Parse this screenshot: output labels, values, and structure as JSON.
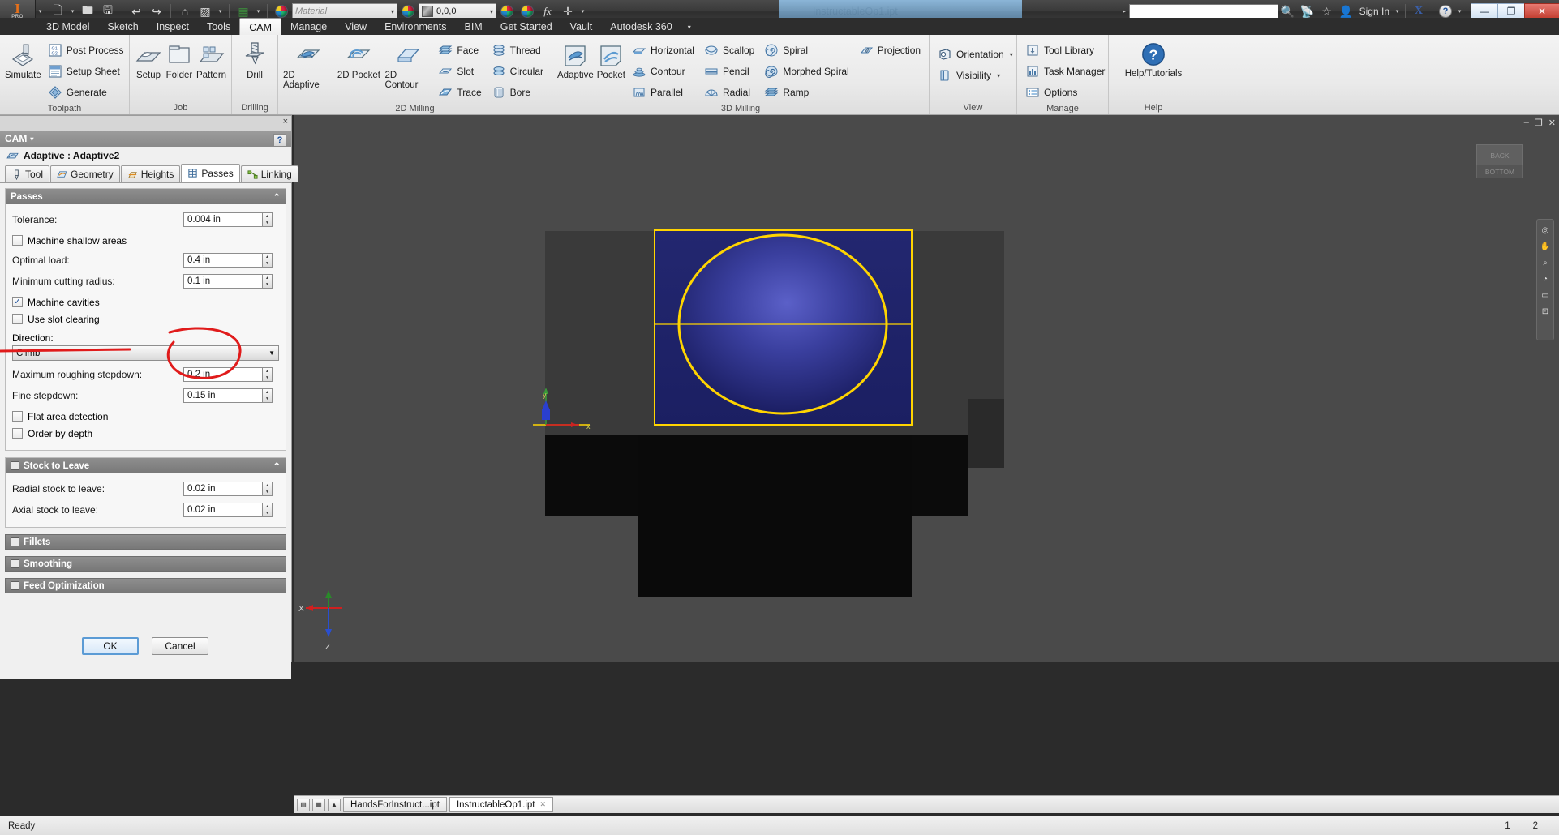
{
  "window": {
    "title": "InstructableOp1.ipt",
    "app_badge": "PRO",
    "app_letter": "I",
    "minimize": "—",
    "restore": "❐",
    "close": "✕",
    "sign_in": "Sign In",
    "help_label": "?",
    "exchange_label": "X"
  },
  "quick_access": {
    "material_placeholder": "Material",
    "appearance_value": "0,0,0",
    "items": [
      {
        "name": "new-icon",
        "glyph": "🗋"
      },
      {
        "name": "open-icon",
        "glyph": "🖿"
      },
      {
        "name": "save-icon",
        "glyph": "🖫"
      },
      {
        "name": "undo-icon",
        "glyph": "↩"
      },
      {
        "name": "redo-icon",
        "glyph": "↪"
      },
      {
        "name": "home-icon",
        "glyph": "⌂"
      },
      {
        "name": "return-icon",
        "glyph": "◳"
      },
      {
        "name": "update-icon",
        "glyph": "▣"
      },
      {
        "name": "appearance-icon",
        "glyph": "◉"
      }
    ],
    "extra": [
      {
        "name": "adjust-icon",
        "glyph": "◍"
      },
      {
        "name": "clear-icon",
        "glyph": "◍"
      },
      {
        "name": "fx-icon",
        "glyph": "fx"
      },
      {
        "name": "add-icon",
        "glyph": "✛"
      },
      {
        "name": "more-icon",
        "glyph": "▾"
      }
    ]
  },
  "menu": {
    "tabs": [
      {
        "label": "3D Model",
        "active": false
      },
      {
        "label": "Sketch",
        "active": false
      },
      {
        "label": "Inspect",
        "active": false
      },
      {
        "label": "Tools",
        "active": false
      },
      {
        "label": "CAM",
        "active": true
      },
      {
        "label": "Manage",
        "active": false
      },
      {
        "label": "View",
        "active": false
      },
      {
        "label": "Environments",
        "active": false
      },
      {
        "label": "BIM",
        "active": false
      },
      {
        "label": "Get Started",
        "active": false
      },
      {
        "label": "Vault",
        "active": false
      },
      {
        "label": "Autodesk 360",
        "active": false
      }
    ],
    "overflow_caret": "▾"
  },
  "ribbon": {
    "groups": [
      {
        "label": "Toolpath",
        "big": [
          {
            "label": "Simulate",
            "icon": "simulate-icon"
          }
        ],
        "small": [
          {
            "label": "Post Process",
            "icon": "post-process-icon"
          },
          {
            "label": "Setup Sheet",
            "icon": "setup-sheet-icon"
          },
          {
            "label": "Generate",
            "icon": "generate-icon"
          }
        ]
      },
      {
        "label": "Job",
        "big": [
          {
            "label": "Setup",
            "icon": "setup-icon"
          },
          {
            "label": "Folder",
            "icon": "folder-icon"
          },
          {
            "label": "Pattern",
            "icon": "pattern-icon"
          }
        ],
        "small": []
      },
      {
        "label": "Drilling",
        "big": [
          {
            "label": "Drill",
            "icon": "drill-icon"
          }
        ],
        "small": []
      },
      {
        "label": "2D Milling",
        "big": [
          {
            "label": "2D Adaptive",
            "icon": "2d-adaptive-icon"
          },
          {
            "label": "2D Pocket",
            "icon": "2d-pocket-icon"
          },
          {
            "label": "2D Contour",
            "icon": "2d-contour-icon"
          }
        ],
        "small_cols": [
          [
            {
              "label": "Face",
              "icon": "face-icon"
            },
            {
              "label": "Slot",
              "icon": "slot-icon"
            },
            {
              "label": "Trace",
              "icon": "trace-icon"
            }
          ],
          [
            {
              "label": "Thread",
              "icon": "thread-icon"
            },
            {
              "label": "Circular",
              "icon": "circular-icon"
            },
            {
              "label": "Bore",
              "icon": "bore-icon"
            }
          ]
        ]
      },
      {
        "label": "3D Milling",
        "big": [
          {
            "label": "Adaptive",
            "icon": "adaptive-icon"
          },
          {
            "label": "Pocket",
            "icon": "pocket-icon"
          }
        ],
        "small_cols": [
          [
            {
              "label": "Horizontal",
              "icon": "horizontal-icon"
            },
            {
              "label": "Contour",
              "icon": "contour-icon"
            },
            {
              "label": "Parallel",
              "icon": "parallel-icon"
            }
          ],
          [
            {
              "label": "Scallop",
              "icon": "scallop-icon"
            },
            {
              "label": "Pencil",
              "icon": "pencil-icon"
            },
            {
              "label": "Radial",
              "icon": "radial-icon"
            }
          ],
          [
            {
              "label": "Spiral",
              "icon": "spiral-icon"
            },
            {
              "label": "Morphed Spiral",
              "icon": "morphed-spiral-icon"
            },
            {
              "label": "Ramp",
              "icon": "ramp-icon"
            }
          ],
          [
            {
              "label": "Projection",
              "icon": "projection-icon"
            }
          ]
        ]
      },
      {
        "label": "View",
        "small_cols": [
          [
            {
              "label": "Orientation",
              "icon": "orientation-icon",
              "caret": "▾"
            },
            {
              "label": "Visibility",
              "icon": "visibility-icon",
              "caret": "▾"
            }
          ]
        ]
      },
      {
        "label": "Manage",
        "small_cols": [
          [
            {
              "label": "Tool Library",
              "icon": "tool-library-icon"
            },
            {
              "label": "Task Manager",
              "icon": "task-manager-icon"
            },
            {
              "label": "Options",
              "icon": "options-icon"
            }
          ]
        ]
      },
      {
        "label": "Help",
        "big": [
          {
            "label": "Help/Tutorials",
            "icon": "help-icon"
          }
        ]
      }
    ]
  },
  "browser": {
    "panel_title": "CAM",
    "panel_caret": "▾",
    "help_button": "?",
    "close_button": "×",
    "operation_title": "Adaptive : Adaptive2",
    "tabs": [
      {
        "label": "Tool",
        "icon": "tool-icon",
        "active": false
      },
      {
        "label": "Geometry",
        "icon": "geometry-icon",
        "active": false
      },
      {
        "label": "Heights",
        "icon": "heights-icon",
        "active": false
      },
      {
        "label": "Passes",
        "icon": "passes-icon",
        "active": true
      },
      {
        "label": "Linking",
        "icon": "linking-icon",
        "active": false
      }
    ],
    "passes": {
      "header": "Passes",
      "collapse_glyph": "⌃",
      "tolerance_label": "Tolerance:",
      "tolerance_value": "0.004 in",
      "machine_shallow_label": "Machine shallow areas",
      "machine_shallow_checked": false,
      "optimal_load_label": "Optimal load:",
      "optimal_load_value": "0.4 in",
      "min_cutting_radius_label": "Minimum cutting radius:",
      "min_cutting_radius_value": "0.1 in",
      "machine_cavities_label": "Machine cavities",
      "machine_cavities_checked": true,
      "use_slot_clearing_label": "Use slot clearing",
      "use_slot_clearing_checked": false,
      "direction_label": "Direction:",
      "direction_value": "Climb",
      "max_roughing_stepdown_label": "Maximum roughing stepdown:",
      "max_roughing_stepdown_value": "0.2 in",
      "fine_stepdown_label": "Fine stepdown:",
      "fine_stepdown_value": "0.15 in",
      "flat_area_detection_label": "Flat area detection",
      "flat_area_detection_checked": false,
      "order_by_depth_label": "Order by depth",
      "order_by_depth_checked": false
    },
    "stock_to_leave": {
      "header": "Stock to Leave",
      "checked": true,
      "collapse_glyph": "⌃",
      "radial_label": "Radial stock to leave:",
      "radial_value": "0.02 in",
      "axial_label": "Axial stock to leave:",
      "axial_value": "0.02 in"
    },
    "collapsed_sections": [
      {
        "label": "Fillets"
      },
      {
        "label": "Smoothing"
      },
      {
        "label": "Feed Optimization"
      }
    ],
    "ok_label": "OK",
    "cancel_label": "Cancel"
  },
  "viewport": {
    "cube_top": "BACK",
    "cube_bottom": "BOTTOM",
    "axis_x": "x",
    "axis_y": "y",
    "axis_z": "z",
    "origin_x": "X",
    "origin_z": "Z",
    "min_glyph": "–",
    "restore_glyph": "❐",
    "close_glyph": "✕",
    "nav_icons": [
      "◎",
      "✋",
      "◔",
      "▭",
      "⊡"
    ],
    "colors": {
      "stock_face": "#2b2f7a",
      "toolpath": "#ffd400",
      "background": "#4a4a4a",
      "part_dark": "#0a0a0a"
    }
  },
  "doc_tabs": {
    "buttons": [
      "▤",
      "▦",
      "▲"
    ],
    "tabs": [
      {
        "label": "HandsForInstruct...ipt",
        "active": false,
        "close": ""
      },
      {
        "label": "InstructableOp1.ipt",
        "active": true,
        "close": "✕"
      }
    ]
  },
  "status": {
    "text": "Ready",
    "right": [
      "1",
      "2"
    ]
  },
  "annotations": {
    "circle_color": "#e01b1b",
    "underline_color": "#e01b1b"
  }
}
